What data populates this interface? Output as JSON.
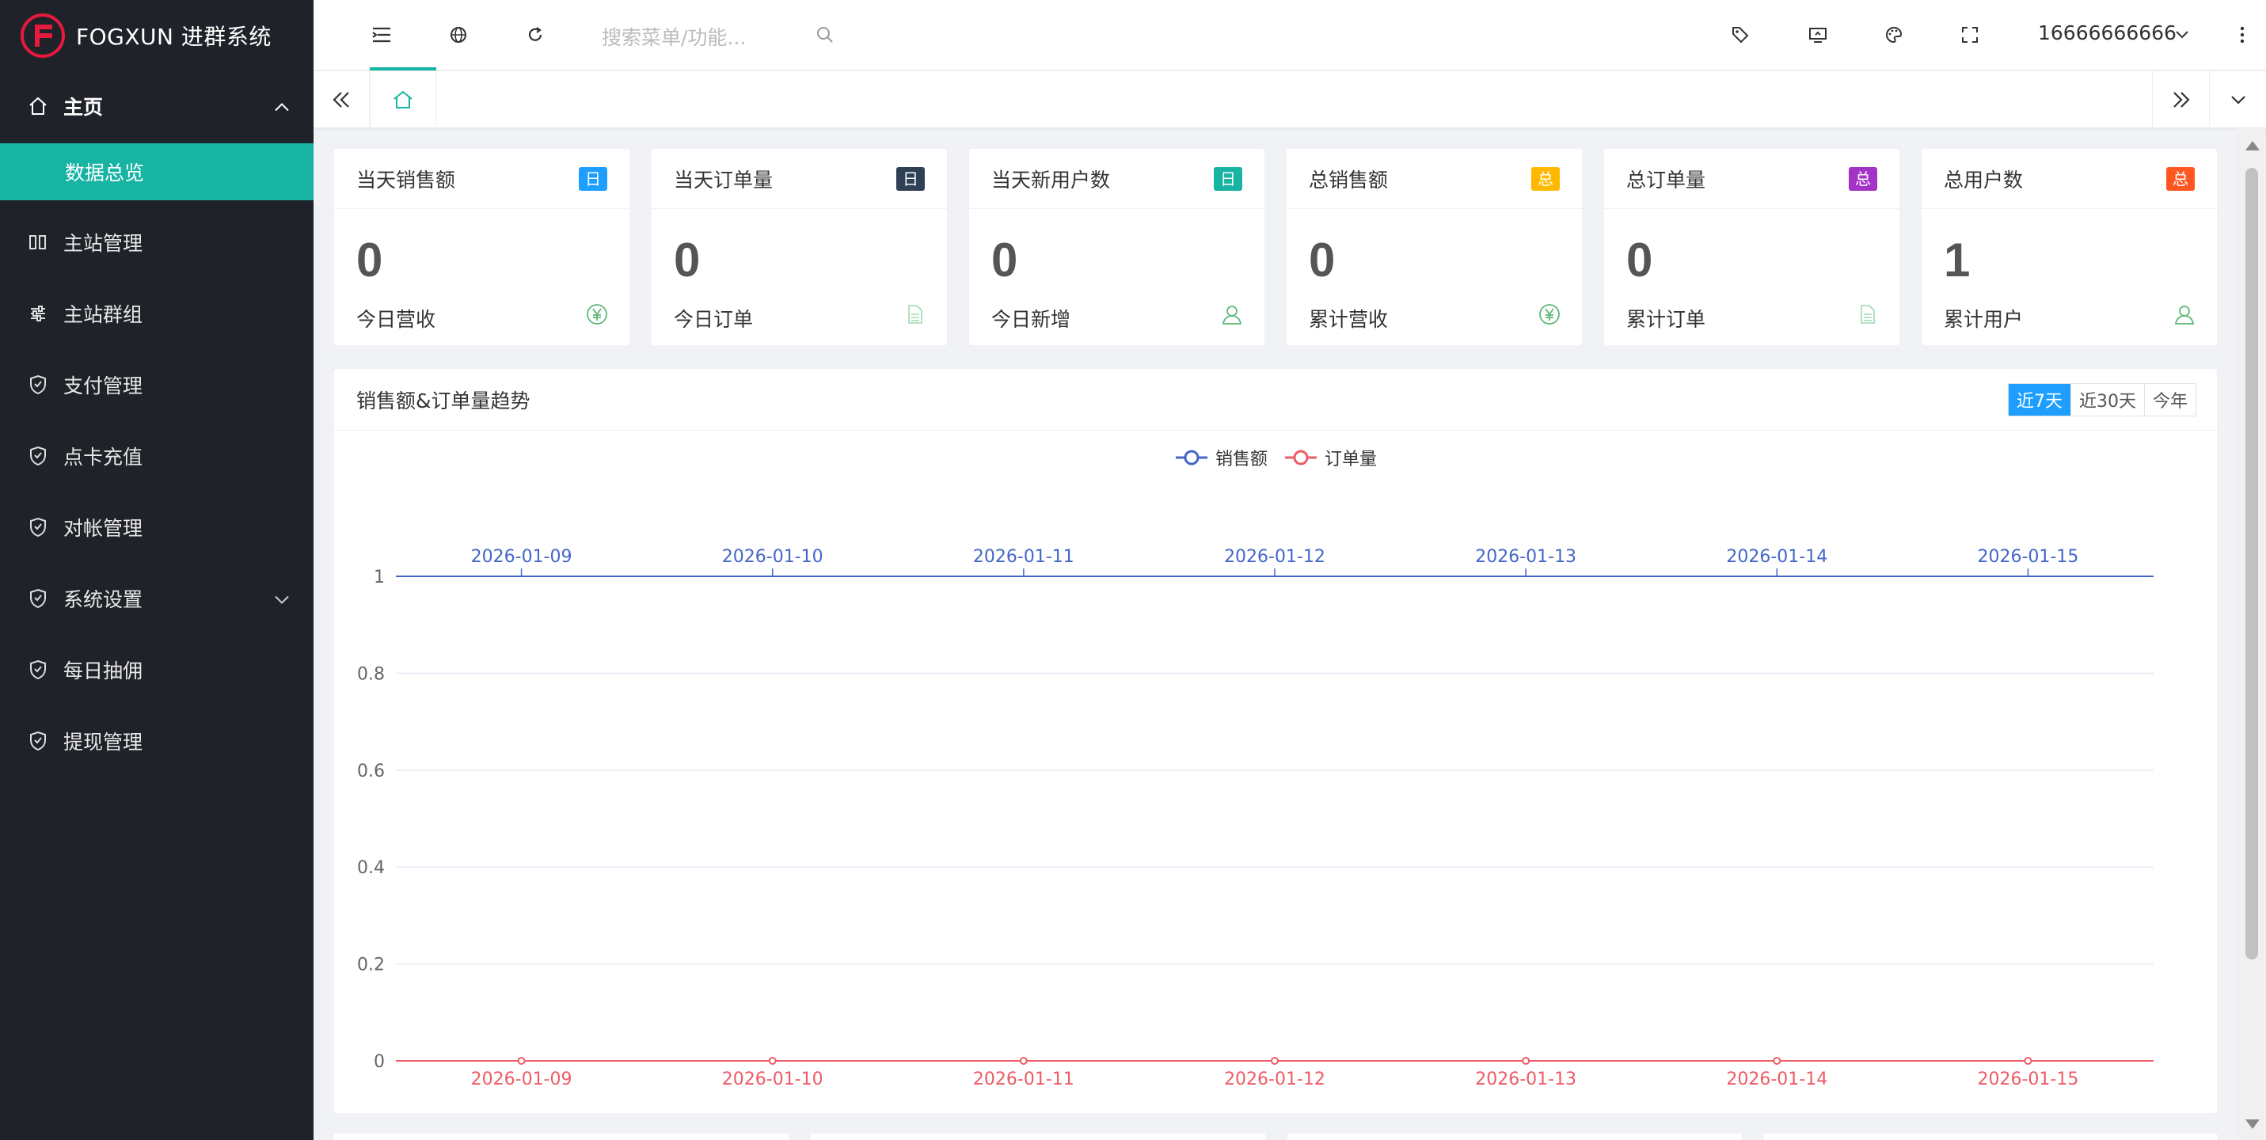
{
  "sidebar": {
    "logo_text": "FOGXUN 进群系统",
    "menu": [
      {
        "label": "主页",
        "icon": "home-icon"
      },
      {
        "label": "数据总览"
      },
      {
        "label": "主站管理",
        "icon": "columns-icon"
      },
      {
        "label": "主站群组",
        "icon": "sliders-icon"
      },
      {
        "label": "支付管理",
        "icon": "shield-icon"
      },
      {
        "label": "点卡充值",
        "icon": "shield-icon"
      },
      {
        "label": "对帐管理",
        "icon": "shield-icon"
      },
      {
        "label": "系统设置",
        "icon": "shield-icon"
      },
      {
        "label": "每日抽佣",
        "icon": "shield-icon"
      },
      {
        "label": "提现管理",
        "icon": "shield-icon"
      }
    ]
  },
  "header": {
    "search_placeholder": "搜索菜单/功能...",
    "user": "16666666666",
    "icons": [
      "menu-toggle-icon",
      "globe-icon",
      "refresh-icon",
      "search-icon",
      "tag-icon",
      "note-icon",
      "theme-icon",
      "fullscreen-icon",
      "chevron-down-icon",
      "more-icon"
    ]
  },
  "tabs": {
    "home_icon": "home-icon"
  },
  "cards": [
    {
      "title": "当天销售额",
      "badge": "日",
      "badge_color": "#1e9fff",
      "value": "0",
      "footer": "今日营收",
      "icon": "yuan-icon"
    },
    {
      "title": "当天订单量",
      "badge": "日",
      "badge_color": "#2f4056",
      "value": "0",
      "footer": "今日订单",
      "icon": "document-icon"
    },
    {
      "title": "当天新用户数",
      "badge": "日",
      "badge_color": "#17b3a3",
      "value": "0",
      "footer": "今日新增",
      "icon": "user-icon"
    },
    {
      "title": "总销售额",
      "badge": "总",
      "badge_color": "#ffb800",
      "value": "0",
      "footer": "累计营收",
      "icon": "yuan-icon"
    },
    {
      "title": "总订单量",
      "badge": "总",
      "badge_color": "#a233c6",
      "value": "0",
      "footer": "累计订单",
      "icon": "document-icon"
    },
    {
      "title": "总用户数",
      "badge": "总",
      "badge_color": "#ff5722",
      "value": "1",
      "footer": "累计用户",
      "icon": "user-icon"
    }
  ],
  "chart_panel": {
    "title": "销售额&订单量趋势",
    "ranges": [
      "近7天",
      "近30天",
      "今年"
    ],
    "active_range": "近7天"
  },
  "chart_data": {
    "type": "line",
    "categories": [
      "2026-01-09",
      "2026-01-10",
      "2026-01-11",
      "2026-01-12",
      "2026-01-13",
      "2026-01-14",
      "2026-01-15"
    ],
    "series": [
      {
        "name": "销售额",
        "values": [
          1,
          1,
          1,
          1,
          1,
          1,
          1
        ],
        "color": "#4466c8"
      },
      {
        "name": "订单量",
        "values": [
          0,
          0,
          0,
          0,
          0,
          0,
          0
        ],
        "color": "#ee5b66"
      }
    ],
    "yticks": [
      "0",
      "0.2",
      "0.4",
      "0.6",
      "0.8",
      "1"
    ],
    "ylim": [
      0,
      1
    ],
    "grid": true,
    "legend": "top-center"
  }
}
